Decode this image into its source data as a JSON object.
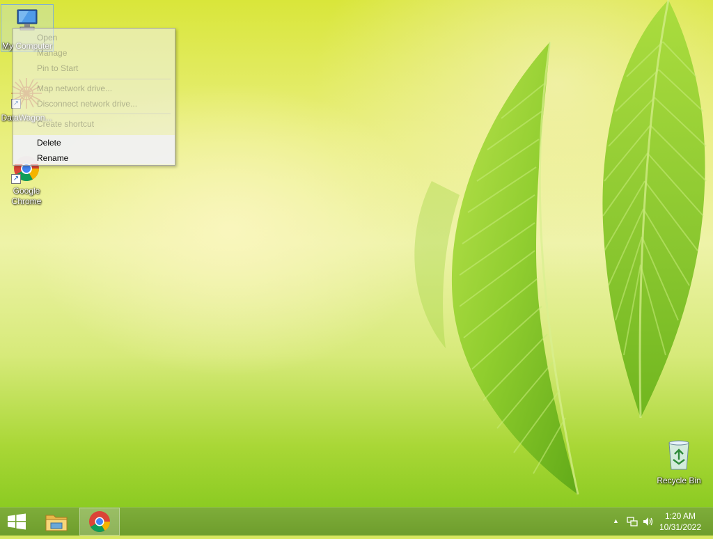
{
  "desktop": {
    "icons": [
      {
        "label": "My Computer"
      },
      {
        "label": "DataWagon..."
      },
      {
        "label": "Google Chrome"
      },
      {
        "label": "Recycle Bin"
      }
    ]
  },
  "context_menu": {
    "items": [
      {
        "label": "Open"
      },
      {
        "label": "Manage"
      },
      {
        "label": "Pin to Start"
      },
      {
        "label": "Map network drive..."
      },
      {
        "label": "Disconnect network drive..."
      },
      {
        "label": "Create shortcut"
      },
      {
        "label": "Delete"
      },
      {
        "label": "Rename"
      }
    ]
  },
  "taskbar": {
    "start_icon": "windows-logo-icon",
    "pinned": [
      {
        "name": "file-explorer-icon"
      },
      {
        "name": "google-chrome-icon",
        "active": true
      }
    ],
    "tray": {
      "icons": [
        "show-hidden-icons-arrow",
        "network-icon",
        "volume-icon"
      ],
      "time": "1:20 AM",
      "date": "10/31/2022"
    }
  },
  "colors": {
    "taskbar": "#7ead3a",
    "wallpaper_accent": "#8ccb22"
  }
}
